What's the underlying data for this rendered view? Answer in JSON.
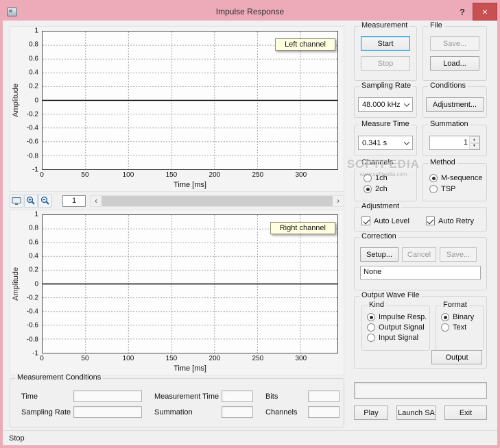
{
  "window": {
    "title": "Impulse Response",
    "help_button": "?",
    "close_button": "×"
  },
  "icons": {
    "scroll_left": "‹",
    "scroll_right": "›",
    "spin_up": "▲",
    "spin_down": "▼"
  },
  "chart_toolbar": {
    "zoom_value": "1"
  },
  "chart_data": [
    {
      "type": "line",
      "title": "Left channel",
      "xlabel": "Time [ms]",
      "ylabel": "Amplitude",
      "xlim": [
        0,
        343
      ],
      "ylim": [
        -1,
        1
      ],
      "xticks": [
        0,
        50,
        100,
        150,
        200,
        250,
        300
      ],
      "yticks": [
        1,
        0.8,
        0.6,
        0.4,
        0.2,
        0,
        -0.2,
        -0.4,
        -0.6,
        -0.8,
        -1
      ],
      "grid": true,
      "legend_position": "top-right",
      "series": [
        {
          "name": "Left channel",
          "x": [
            0,
            343
          ],
          "y": [
            0,
            0
          ]
        }
      ]
    },
    {
      "type": "line",
      "title": "Right channel",
      "xlabel": "Time [ms]",
      "ylabel": "Amplitude",
      "xlim": [
        0,
        343
      ],
      "ylim": [
        -1,
        1
      ],
      "xticks": [
        0,
        50,
        100,
        150,
        200,
        250,
        300
      ],
      "yticks": [
        1,
        0.8,
        0.6,
        0.4,
        0.2,
        0,
        -0.2,
        -0.4,
        -0.6,
        -0.8,
        -1
      ],
      "grid": true,
      "legend_position": "top-right",
      "series": [
        {
          "name": "Right channel",
          "x": [
            0,
            343
          ],
          "y": [
            0,
            0
          ]
        }
      ]
    }
  ],
  "watermark": {
    "line1": "SOFTPEDIA",
    "line2": "www.softpedia.com"
  },
  "panel": {
    "measurement": {
      "label": "Measurement",
      "start": "Start",
      "stop": "Stop"
    },
    "file": {
      "label": "File",
      "save": "Save...",
      "load": "Load..."
    },
    "sampling_rate": {
      "label": "Sampling Rate",
      "value": "48.000 kHz"
    },
    "conditions": {
      "label": "Conditions",
      "adjustment": "Adjustment..."
    },
    "measure_time": {
      "label": "Measure Time",
      "value": "0.341 s"
    },
    "summation": {
      "label": "Summation",
      "value": "1"
    },
    "channels": {
      "label": "Channels",
      "options": [
        {
          "label": "1ch",
          "selected": false
        },
        {
          "label": "2ch",
          "selected": true
        }
      ]
    },
    "method": {
      "label": "Method",
      "options": [
        {
          "label": "M-sequence",
          "selected": true
        },
        {
          "label": "TSP",
          "selected": false
        }
      ]
    },
    "adjustment": {
      "label": "Adjustment",
      "auto_level": {
        "label": "Auto Level",
        "checked": true
      },
      "auto_retry": {
        "label": "Auto Retry",
        "checked": true
      }
    },
    "correction": {
      "label": "Correction",
      "setup": "Setup...",
      "cancel": "Cancel",
      "save": "Save...",
      "value": "None"
    },
    "output_wave": {
      "label": "Output Wave File",
      "kind": {
        "label": "Kind",
        "options": [
          {
            "label": "Impulse Resp.",
            "selected": true
          },
          {
            "label": "Output Signal",
            "selected": false
          },
          {
            "label": "Input Signal",
            "selected": false
          }
        ]
      },
      "format": {
        "label": "Format",
        "options": [
          {
            "label": "Binary",
            "selected": true
          },
          {
            "label": "Text",
            "selected": false
          }
        ]
      },
      "output": "Output"
    },
    "bottom": {
      "display_value": "",
      "play": "Play",
      "launch_sa": "Launch SA",
      "exit": "Exit"
    }
  },
  "conditions_box": {
    "label": "Measurement Conditions",
    "fields": [
      {
        "label": "Time",
        "value": ""
      },
      {
        "label": "Measurement Time",
        "value": ""
      },
      {
        "label": "Bits",
        "value": ""
      },
      {
        "label": "Sampling Rate",
        "value": ""
      },
      {
        "label": "Summation",
        "value": ""
      },
      {
        "label": "Channels",
        "value": ""
      }
    ]
  },
  "status_bar": {
    "text": "Stop"
  }
}
